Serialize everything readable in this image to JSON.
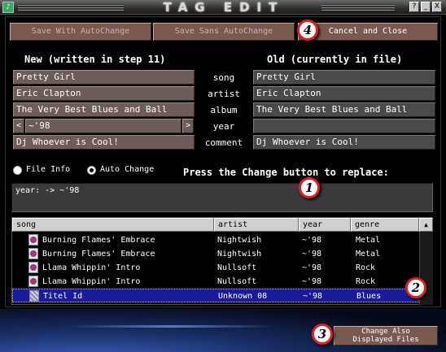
{
  "window": {
    "title": "TAG EDIT",
    "app_icon": "music-note-icon",
    "buttons": [
      "?",
      "_",
      "X"
    ]
  },
  "toolbar": {
    "save_auto": "Save With AutoChange",
    "save_sans": "Save Sans AutoChange",
    "cancel": "Cancel and Close"
  },
  "columns": {
    "new_header": "New (written in step 11)",
    "old_header": "Old (currently in file)"
  },
  "fields": [
    {
      "label": "song",
      "new": "Pretty Girl",
      "old": "Pretty Girl"
    },
    {
      "label": "artist",
      "new": "Eric Clapton",
      "old": "Eric Clapton"
    },
    {
      "label": "album",
      "new": "The Very Best Blues and Ball",
      "old": "The Very Best Blues and Ball"
    },
    {
      "label": "year",
      "new": "~'98",
      "old": ""
    },
    {
      "label": "comment",
      "new": "Dj Whoever is Cool!",
      "old": "Dj Whoever is Cool!"
    }
  ],
  "year_prev": "<",
  "year_next": ">",
  "radios": {
    "file_info": "File Info",
    "auto_change": "Auto Change",
    "selected": "auto_change"
  },
  "instruction": "Press the Change button to replace:",
  "changes_text": "year:  -> ~'98",
  "table": {
    "headers": [
      "song",
      "artist",
      "year",
      "genre"
    ],
    "scroll_up": "▲",
    "rows": [
      {
        "song": "Burning Flames' Embrace",
        "artist": "Nightwish",
        "year": "~'98",
        "genre": "Metal"
      },
      {
        "song": "Burning Flames' Embrace",
        "artist": "Nightwish",
        "year": "~'98",
        "genre": "Metal"
      },
      {
        "song": "Llama Whippin' Intro",
        "artist": "Nullsoft",
        "year": "~'98",
        "genre": "Rock"
      },
      {
        "song": "Llama Whippin' Intro",
        "artist": "Nullsoft",
        "year": "~'98",
        "genre": "Rock"
      },
      {
        "song": "Titel Id",
        "artist": "Unknown 08",
        "year": "~'98",
        "genre": "Blues"
      }
    ]
  },
  "change_all": {
    "line1": "Change Also",
    "line2": "Displayed Files"
  },
  "badges": [
    "1",
    "2",
    "3",
    "4"
  ],
  "colors": {
    "button_bg": "#7a5a50",
    "new_field_bg": "#6e5c58",
    "old_field_bg": "#4a4a4c",
    "selection": "#1a1a9a",
    "badge_ring": "#e02020"
  }
}
